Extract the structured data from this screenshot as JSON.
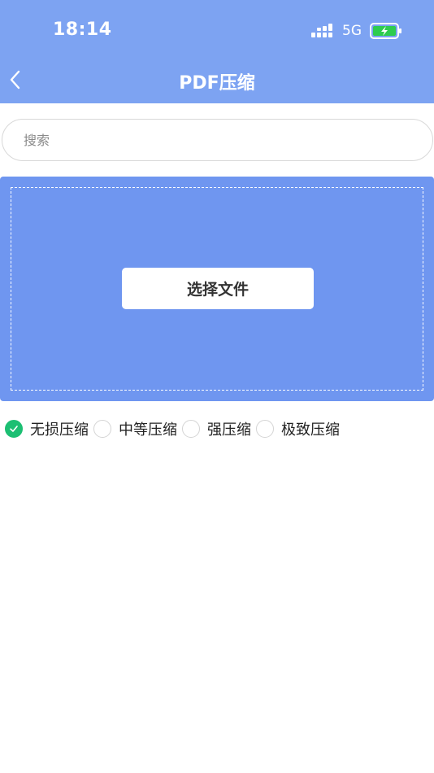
{
  "status_bar": {
    "time": "18:14",
    "network": "5G",
    "icons": [
      "signal-icon",
      "battery-charging-icon"
    ],
    "battery_color": "#2ecc4f"
  },
  "nav": {
    "title": "PDF压缩",
    "back_icon": "chevron-left-icon"
  },
  "search": {
    "placeholder": "搜索",
    "value": ""
  },
  "upload": {
    "button_label": "选择文件"
  },
  "compression_options": [
    {
      "label": "无损压缩",
      "selected": true
    },
    {
      "label": "中等压缩",
      "selected": false
    },
    {
      "label": "强压缩",
      "selected": false
    },
    {
      "label": "极致压缩",
      "selected": false
    }
  ],
  "colors": {
    "header": "#7da3f2",
    "panel": "#6f96f0",
    "selected_radio": "#1cbf73"
  }
}
